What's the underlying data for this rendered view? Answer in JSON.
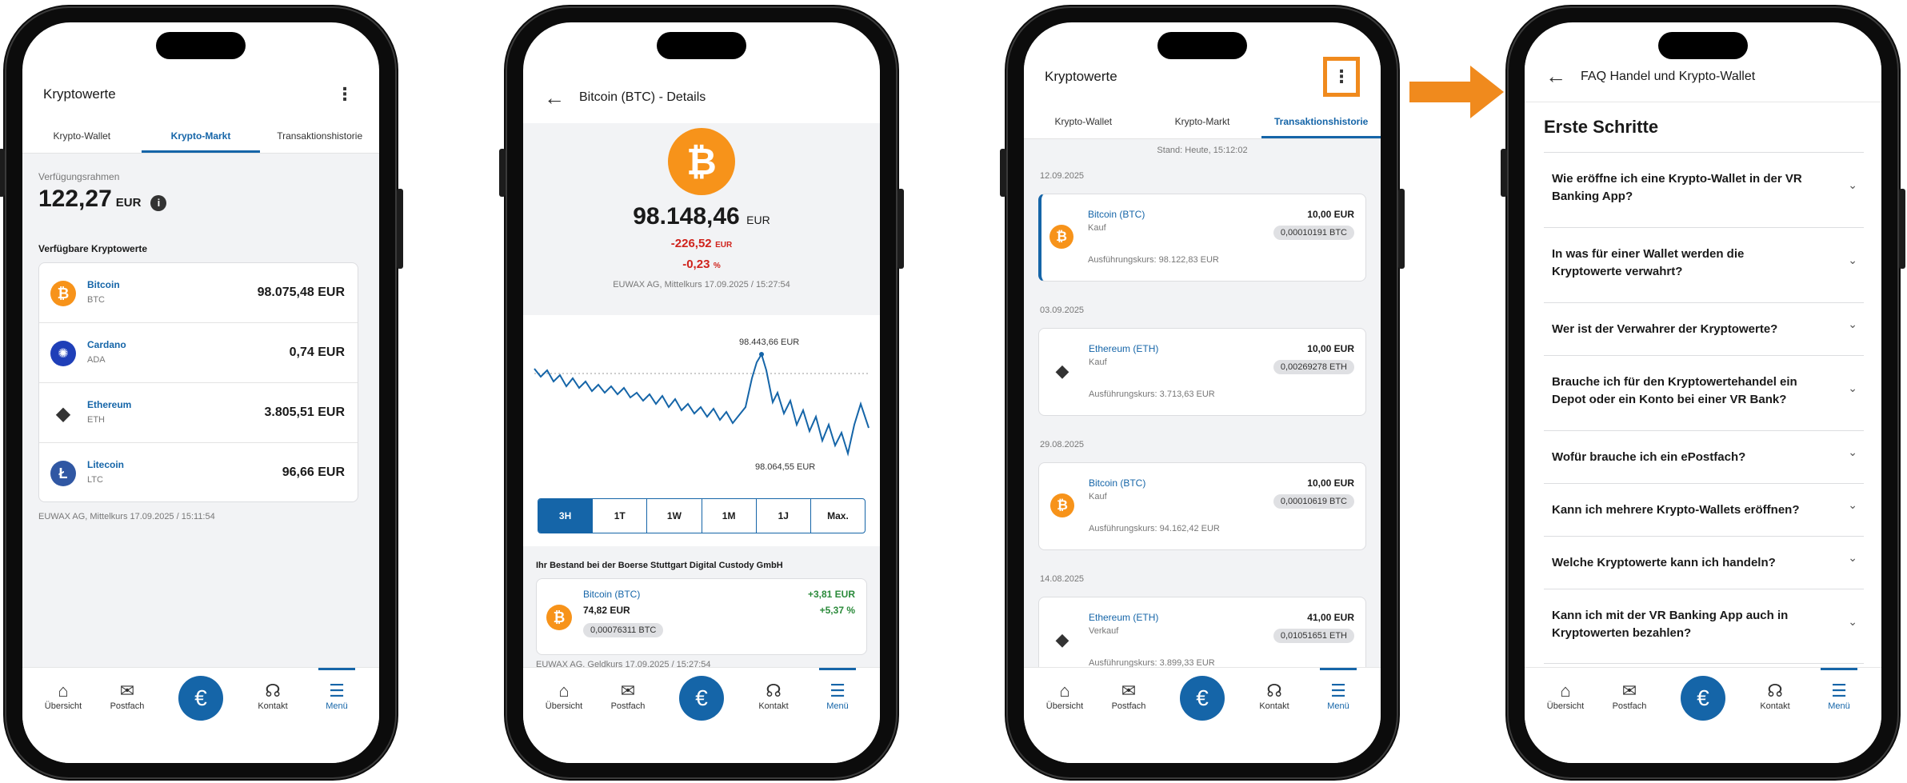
{
  "colors": {
    "brand_blue": "#1565a8",
    "bitcoin_orange": "#f7931a",
    "negative_red": "#d0231c",
    "positive_green": "#2a8a3a",
    "highlight_orange": "#f08a1d"
  },
  "bottom_nav": {
    "overview": "Übersicht",
    "mailbox": "Postfach",
    "euro_symbol": "€",
    "contact": "Kontakt",
    "menu": "Menü",
    "icons": [
      "house-icon",
      "envelope-icon",
      "euro-icon",
      "headset-icon",
      "hamburger-icon"
    ]
  },
  "screen1": {
    "title": "Kryptowerte",
    "tabs": [
      "Krypto-Wallet",
      "Krypto-Markt",
      "Transaktionshistorie"
    ],
    "active_tab": "Krypto-Markt",
    "available_label": "Verfügungsrahmen",
    "available_amount": "122,27",
    "available_currency": "EUR",
    "list_heading": "Verfügbare Kryptowerte",
    "assets": [
      {
        "name": "Bitcoin",
        "symbol": "BTC",
        "price": "98.075,48 EUR",
        "icon": "bitcoin-icon"
      },
      {
        "name": "Cardano",
        "symbol": "ADA",
        "price": "0,74 EUR",
        "icon": "cardano-icon"
      },
      {
        "name": "Ethereum",
        "symbol": "ETH",
        "price": "3.805,51 EUR",
        "icon": "ethereum-icon"
      },
      {
        "name": "Litecoin",
        "symbol": "LTC",
        "price": "96,66 EUR",
        "icon": "litecoin-icon"
      }
    ],
    "footnote": "EUWAX AG, Mittelkurs 17.09.2025 / 15:11:54"
  },
  "screen2": {
    "title": "Bitcoin (BTC) - Details",
    "price": "98.148,46",
    "currency": "EUR",
    "change_abs": "-226,52",
    "change_abs_unit": "EUR",
    "change_pct": "-0,23",
    "change_pct_unit": "%",
    "source": "EUWAX AG, Mittelkurs 17.09.2025 / 15:27:54",
    "chart_high_label": "98.443,66 EUR",
    "chart_low_label": "98.064,55 EUR",
    "ranges": [
      "3H",
      "1T",
      "1W",
      "1M",
      "1J",
      "Max."
    ],
    "active_range": "3H",
    "holding_heading": "Ihr Bestand bei der Boerse Stuttgart Digital Custody GmbH",
    "holding_name": "Bitcoin (BTC)",
    "holding_value": "74,82 EUR",
    "holding_amount": "0,00076311 BTC",
    "holding_gain_abs": "+3,81 EUR",
    "holding_gain_pct": "+5,37 %",
    "footnote": "EUWAX AG, Geldkurs 17.09.2025 / 15:27:54"
  },
  "screen3": {
    "title": "Kryptowerte",
    "tabs": [
      "Krypto-Wallet",
      "Krypto-Markt",
      "Transaktionshistorie"
    ],
    "active_tab": "Transaktionshistorie",
    "status": "Stand: Heute, 15:12:02",
    "groups": [
      {
        "date": "12.09.2025",
        "name": "Bitcoin (BTC)",
        "type": "Kauf",
        "value": "10,00 EUR",
        "amount": "0,00010191 BTC",
        "rate": "Ausführungskurs: 98.122,83 EUR",
        "icon": "bitcoin-icon"
      },
      {
        "date": "03.09.2025",
        "name": "Ethereum (ETH)",
        "type": "Kauf",
        "value": "10,00 EUR",
        "amount": "0,00269278 ETH",
        "rate": "Ausführungskurs: 3.713,63 EUR",
        "icon": "ethereum-icon"
      },
      {
        "date": "29.08.2025",
        "name": "Bitcoin (BTC)",
        "type": "Kauf",
        "value": "10,00 EUR",
        "amount": "0,00010619 BTC",
        "rate": "Ausführungskurs: 94.162,42 EUR",
        "icon": "bitcoin-icon"
      },
      {
        "date": "14.08.2025",
        "name": "Ethereum (ETH)",
        "type": "Verkauf",
        "value": "41,00 EUR",
        "amount": "0,01051651 ETH",
        "rate": "Ausführungskurs: 3.899,33 EUR",
        "icon": "ethereum-icon"
      }
    ]
  },
  "screen4": {
    "title": "FAQ Handel und Krypto-Wallet",
    "section": "Erste Schritte",
    "questions": [
      "Wie eröffne ich eine Krypto-Wallet in der VR Banking App?",
      "In was für einer Wallet werden die Kryptowerte verwahrt?",
      "Wer ist der Verwahrer der Kryptowerte?",
      "Brauche ich für den Kryptowertehandel ein Depot oder ein Konto bei einer VR Bank?",
      "Wofür brauche ich ein ePostfach?",
      "Kann ich mehrere Krypto-Wallets eröffnen?",
      "Welche Kryptowerte kann ich handeln?",
      "Kann ich mit der VR Banking App auch in Kryptowerten bezahlen?"
    ]
  }
}
